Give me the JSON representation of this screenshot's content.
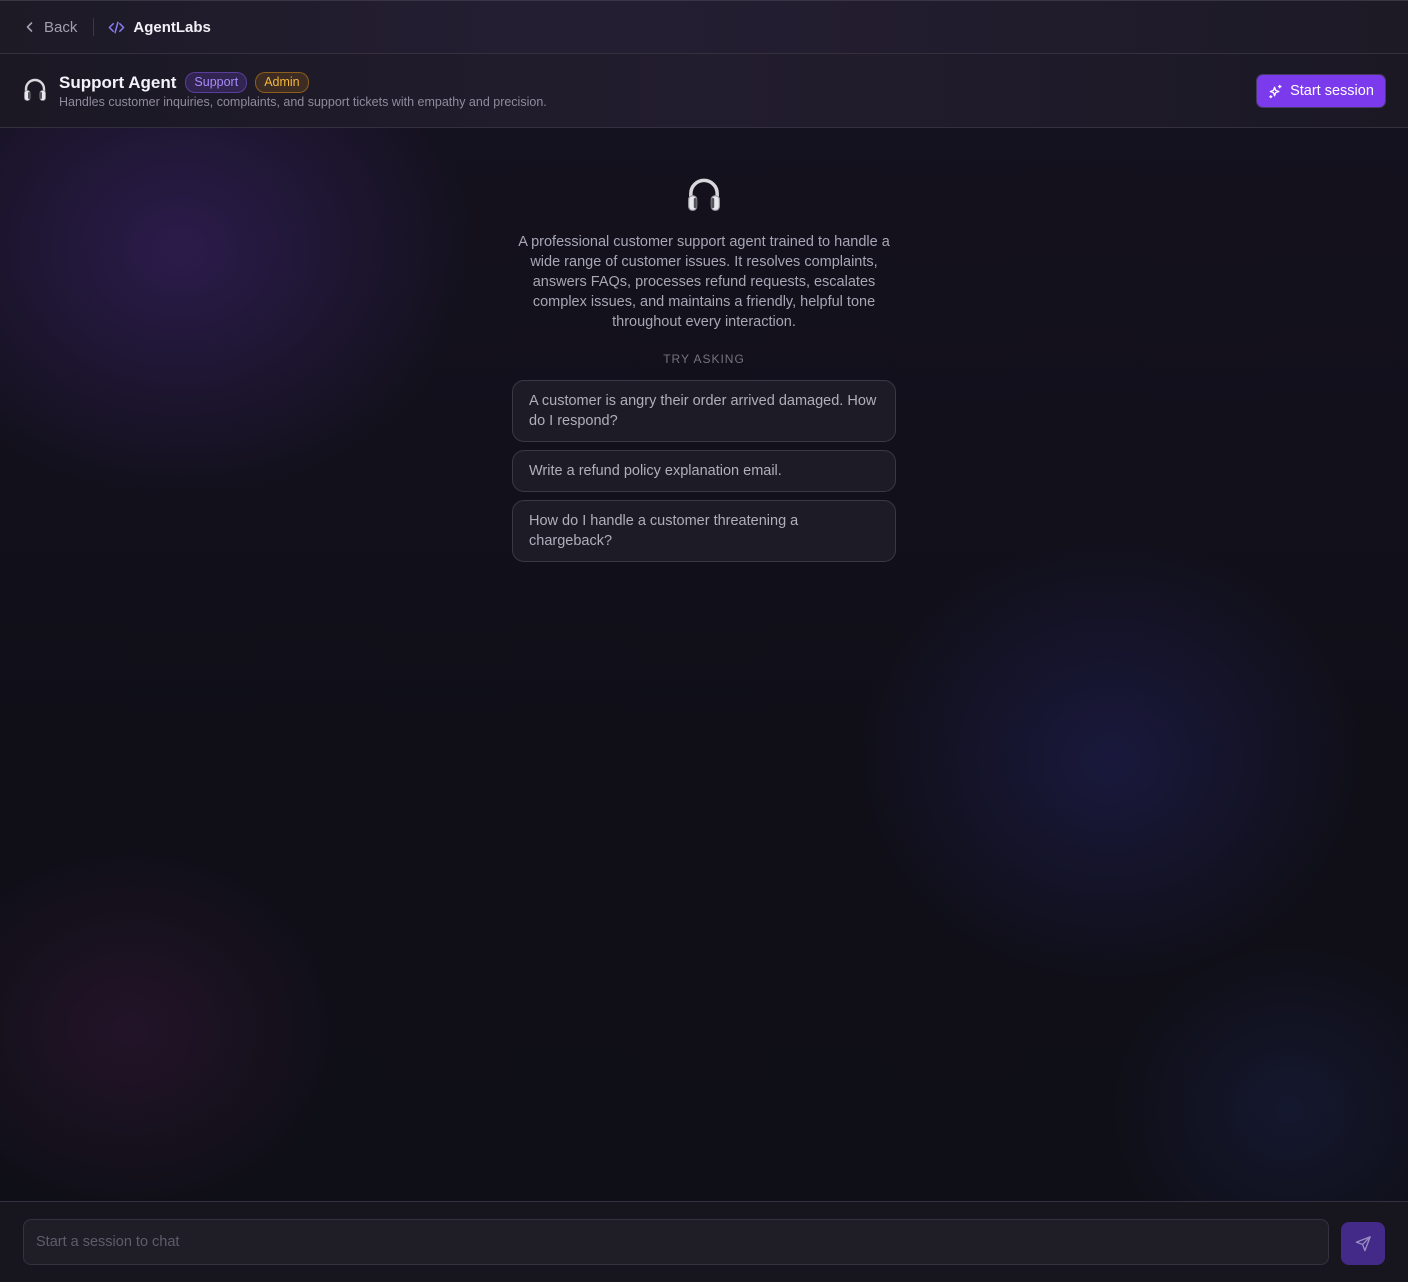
{
  "topbar": {
    "back_label": "Back",
    "brand_name": "AgentLabs",
    "brand_icon": "code-icon"
  },
  "agent": {
    "title": "Support Agent",
    "badges": [
      "Support",
      "Admin"
    ],
    "subtitle": "Handles customer inquiries, complaints, and support tickets with empathy and precision.",
    "icon": "headphones-icon",
    "start_button_label": "Start session",
    "start_button_icon": "sparkles-icon",
    "description": "A professional customer support agent trained to handle a wide range of customer issues. It resolves complaints, answers FAQs, processes refund requests, escalates complex issues, and maintains a friendly, helpful tone throughout every interaction."
  },
  "suggestions": {
    "heading": "TRY ASKING",
    "items": [
      "A customer is angry their order arrived damaged. How do I respond?",
      "Write a refund policy explanation email.",
      "How do I handle a customer threatening a chargeback?"
    ]
  },
  "composer": {
    "placeholder": "Start a session to chat",
    "send_icon": "send-icon"
  },
  "colors": {
    "accent": "#7c3aed",
    "support_badge": "#a78bfa",
    "admin_badge": "#f5b73b",
    "background": "#0f0e17"
  }
}
